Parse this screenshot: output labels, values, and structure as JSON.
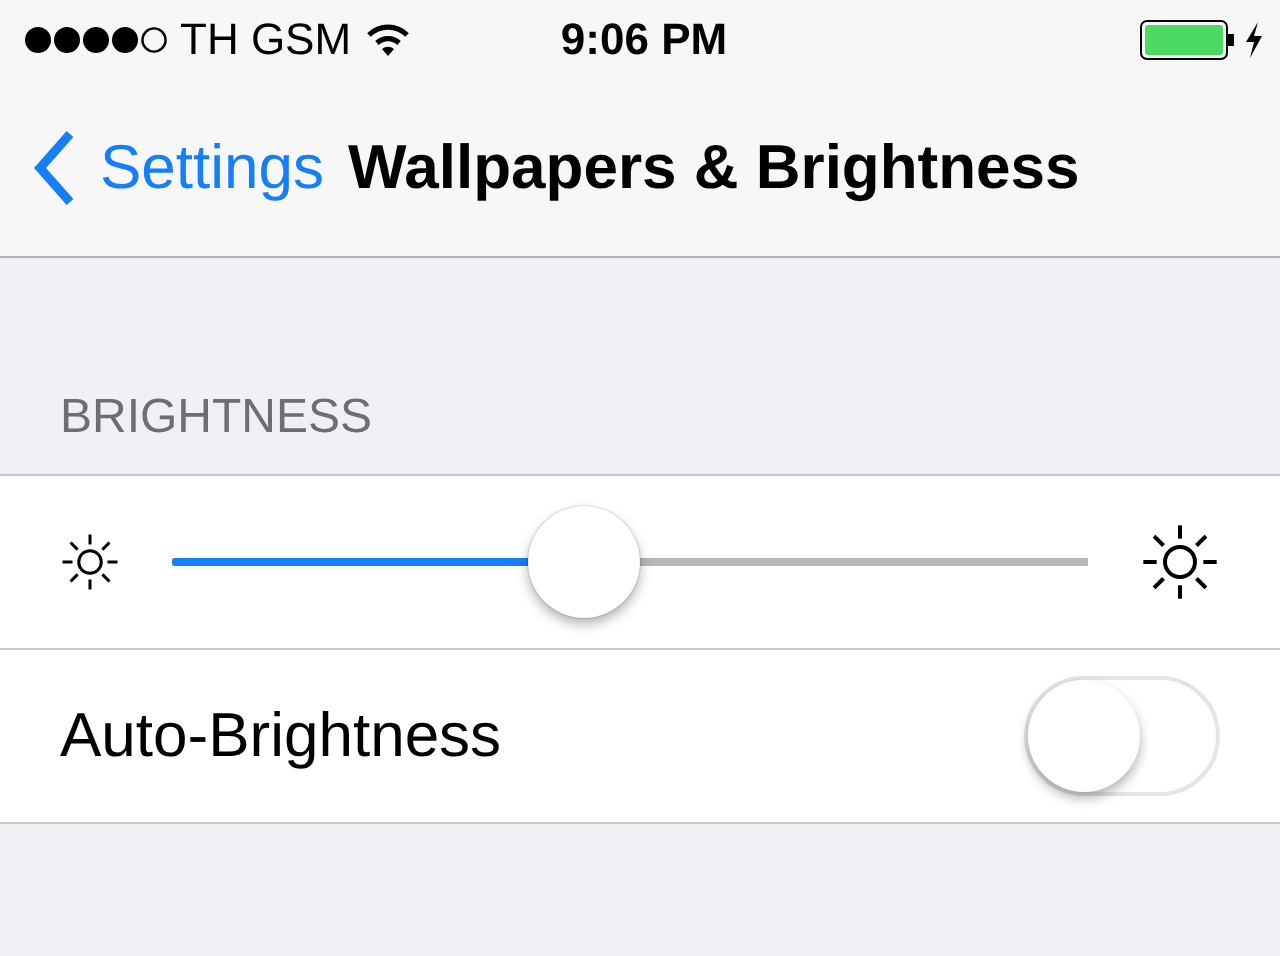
{
  "status_bar": {
    "carrier": "TH GSM",
    "time": "9:06 PM"
  },
  "nav": {
    "back": "Settings",
    "title": "Wallpapers & Brightness"
  },
  "section": {
    "header": "BRIGHTNESS"
  },
  "brightness": {
    "level": 0.45
  },
  "auto_brightness": {
    "label": "Auto-Brightness",
    "on": false
  }
}
